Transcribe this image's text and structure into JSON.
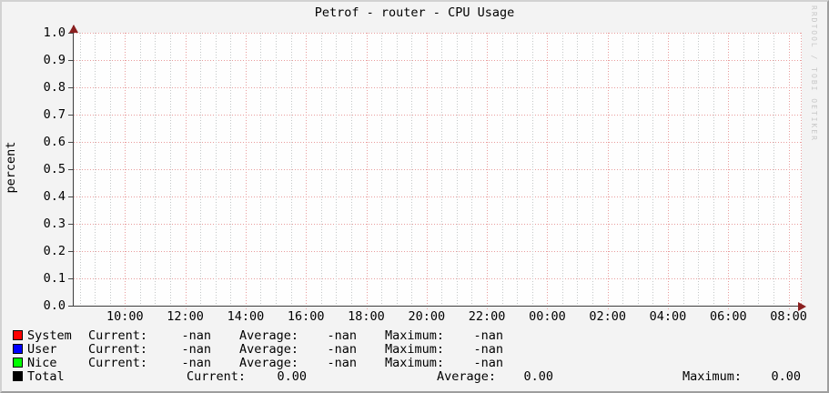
{
  "title": "Petrof - router - CPU Usage",
  "watermark": "RRDTOOL / TOBI OETIKER",
  "y_axis": {
    "title": "percent",
    "tick_labels": [
      "1.0",
      "0.9",
      "0.8",
      "0.7",
      "0.6",
      "0.5",
      "0.4",
      "0.3",
      "0.2",
      "0.1",
      "0.0"
    ]
  },
  "x_axis": {
    "tick_labels": [
      "10:00",
      "12:00",
      "14:00",
      "16:00",
      "18:00",
      "20:00",
      "22:00",
      "00:00",
      "02:00",
      "04:00",
      "06:00",
      "08:00"
    ]
  },
  "legend": {
    "rows": [
      {
        "swatch_color": "#FF0000",
        "label": "System",
        "current_label": "Current:",
        "current_value": "-nan",
        "average_label": "Average:",
        "average_value": "-nan",
        "maximum_label": "Maximum:",
        "maximum_value": "-nan",
        "wide": false
      },
      {
        "swatch_color": "#0000FF",
        "label": "User",
        "current_label": "Current:",
        "current_value": "-nan",
        "average_label": "Average:",
        "average_value": "-nan",
        "maximum_label": "Maximum:",
        "maximum_value": "-nan",
        "wide": false
      },
      {
        "swatch_color": "#00FF00",
        "label": "Nice",
        "current_label": "Current:",
        "current_value": "-nan",
        "average_label": "Average:",
        "average_value": "-nan",
        "maximum_label": "Maximum:",
        "maximum_value": "-nan",
        "wide": false
      },
      {
        "swatch_color": "#000000",
        "label": "Total",
        "current_label": "Current:",
        "current_value": "0.00",
        "average_label": "Average:",
        "average_value": "0.00",
        "maximum_label": "Maximum:",
        "maximum_value": "0.00",
        "wide": true
      }
    ]
  },
  "colors": {
    "background": "#f3f3f3",
    "canvas": "#fefefe",
    "major_grid": "#e89c9c",
    "minor_grid": "#c3c7c7",
    "axis": "#3d3d3d",
    "arrow": "#8a1f1f",
    "watermark_text": "#c8c8c8"
  },
  "chart_data": {
    "type": "line",
    "title": "Petrof - router - CPU Usage",
    "xlabel": "",
    "ylabel": "percent",
    "ylim": [
      0.0,
      1.0
    ],
    "y_tick_interval": 0.1,
    "x_tick_labels": [
      "10:00",
      "12:00",
      "14:00",
      "16:00",
      "18:00",
      "20:00",
      "22:00",
      "00:00",
      "02:00",
      "04:00",
      "06:00",
      "08:00"
    ],
    "x_minor_tick_minutes": 30,
    "grid": true,
    "legend_position": "bottom",
    "series": [
      {
        "name": "System",
        "color": "#FF0000",
        "values": [],
        "current": "-nan",
        "average": "-nan",
        "maximum": "-nan"
      },
      {
        "name": "User",
        "color": "#0000FF",
        "values": [],
        "current": "-nan",
        "average": "-nan",
        "maximum": "-nan"
      },
      {
        "name": "Nice",
        "color": "#00FF00",
        "values": [],
        "current": "-nan",
        "average": "-nan",
        "maximum": "-nan"
      },
      {
        "name": "Total",
        "color": "#000000",
        "values": [],
        "current": "0.00",
        "average": "0.00",
        "maximum": "0.00"
      }
    ]
  }
}
